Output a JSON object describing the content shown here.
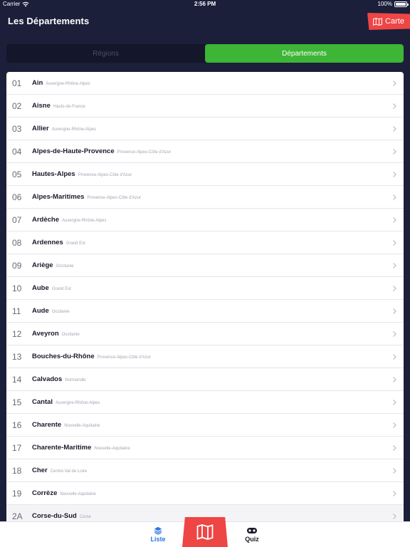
{
  "status": {
    "carrier": "Carrier",
    "time": "2:56 PM",
    "battery": "100%",
    "battery_level": 1.0
  },
  "nav": {
    "title": "Les Départements",
    "map_label": "Carte"
  },
  "segments": {
    "regions": "Régions",
    "departements": "Départements",
    "selected": "Départements"
  },
  "rows": [
    {
      "code": "01",
      "name": "Ain",
      "region": "Auvergne-Rhône-Alpes"
    },
    {
      "code": "02",
      "name": "Aisne",
      "region": "Hauts-de-France"
    },
    {
      "code": "03",
      "name": "Allier",
      "region": "Auvergne-Rhône-Alpes"
    },
    {
      "code": "04",
      "name": "Alpes-de-Haute-Provence",
      "region": "Provence-Alpes-Côte d'Azur"
    },
    {
      "code": "05",
      "name": "Hautes-Alpes",
      "region": "Provence-Alpes-Côte d'Azur"
    },
    {
      "code": "06",
      "name": "Alpes-Maritimes",
      "region": "Provence-Alpes-Côte d'Azur"
    },
    {
      "code": "07",
      "name": "Ardèche",
      "region": "Auvergne-Rhône-Alpes"
    },
    {
      "code": "08",
      "name": "Ardennes",
      "region": "Grand Est"
    },
    {
      "code": "09",
      "name": "Ariège",
      "region": "Occitanie"
    },
    {
      "code": "10",
      "name": "Aube",
      "region": "Grand Est"
    },
    {
      "code": "11",
      "name": "Aude",
      "region": "Occitanie"
    },
    {
      "code": "12",
      "name": "Aveyron",
      "region": "Occitanie"
    },
    {
      "code": "13",
      "name": "Bouches-du-Rhône",
      "region": "Provence-Alpes-Côte d'Azur"
    },
    {
      "code": "14",
      "name": "Calvados",
      "region": "Normandie"
    },
    {
      "code": "15",
      "name": "Cantal",
      "region": "Auvergne-Rhône-Alpes"
    },
    {
      "code": "16",
      "name": "Charente",
      "region": "Nouvelle-Aquitaine"
    },
    {
      "code": "17",
      "name": "Charente-Maritime",
      "region": "Nouvelle-Aquitaine"
    },
    {
      "code": "18",
      "name": "Cher",
      "region": "Centre-Val de Loire"
    },
    {
      "code": "19",
      "name": "Corrèze",
      "region": "Nouvelle-Aquitaine"
    },
    {
      "code": "2A",
      "name": "Corse-du-Sud",
      "region": "Corse"
    }
  ],
  "tabs": {
    "liste": "Liste",
    "quiz": "Quiz",
    "selected": "Liste"
  },
  "icons": {
    "map": "map-icon",
    "chevron": "chevron-right-icon",
    "liste": "layers-icon",
    "quiz": "gamepad-icon",
    "wifi": "wifi-icon",
    "battery": "battery-icon"
  },
  "colors": {
    "background": "#1c1f3a",
    "accent_red": "#ee4545",
    "accent_green": "#3db536",
    "tab_active": "#2b78e4",
    "list_background": "#ffffff"
  }
}
